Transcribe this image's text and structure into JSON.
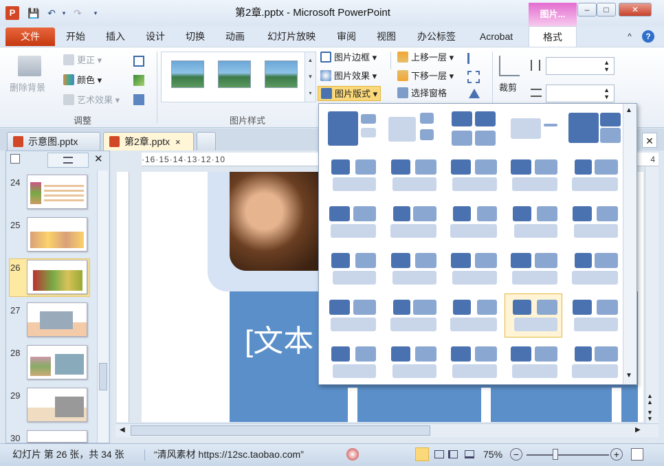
{
  "window": {
    "title": "第2章.pptx - Microsoft PowerPoint",
    "context_tab_header": "图片...",
    "minimize": "–",
    "maximize": "□",
    "close": "✕"
  },
  "quick_access": {
    "app_letter": "P",
    "save": "💾",
    "undo": "↶",
    "redo": "↷",
    "customize": "▾"
  },
  "ribbon_tabs": [
    "文件",
    "开始",
    "插入",
    "设计",
    "切换",
    "动画",
    "幻灯片放映",
    "审阅",
    "视图",
    "办公标签",
    "Acrobat",
    "格式"
  ],
  "ribbon_right": {
    "collapse": "^",
    "help": "?"
  },
  "ribbon": {
    "adjust": {
      "remove_bg": "删除背景",
      "corrections": "更正",
      "color": "颜色",
      "artistic": "艺术效果",
      "label": "调整"
    },
    "picture_styles": {
      "label": "图片样式",
      "border": "图片边框",
      "effects": "图片效果",
      "layout": "图片版式"
    },
    "arrange": {
      "bring_forward": "上移一层",
      "send_backward": "下移一层",
      "selection_pane": "选择窗格"
    },
    "size": {
      "crop": "裁剪"
    }
  },
  "doc_tabs": [
    {
      "label": "示意图.pptx",
      "active": false
    },
    {
      "label": "第2章.pptx",
      "active": true,
      "close": "×"
    }
  ],
  "doc_tabs_close": "✕",
  "thumb_panel": {
    "close": "✕",
    "slides": [
      {
        "number": "24"
      },
      {
        "number": "25"
      },
      {
        "number": "26",
        "selected": true
      },
      {
        "number": "27"
      },
      {
        "number": "28"
      },
      {
        "number": "29"
      },
      {
        "number": "30"
      }
    ]
  },
  "ruler_h": "·16·15·14·13·12·10",
  "ruler_h_right": "4",
  "slide": {
    "placeholder_text": "[文本"
  },
  "status": {
    "slide_info": "幻灯片 第 26 张，共 34 张",
    "theme": "“清风素材 https://12sc.taobao.com”",
    "zoom": "75%",
    "zoom_minus": "−",
    "zoom_plus": "+"
  },
  "dropdown": {
    "rows": 6,
    "cols": 5,
    "selected_index": 23
  }
}
